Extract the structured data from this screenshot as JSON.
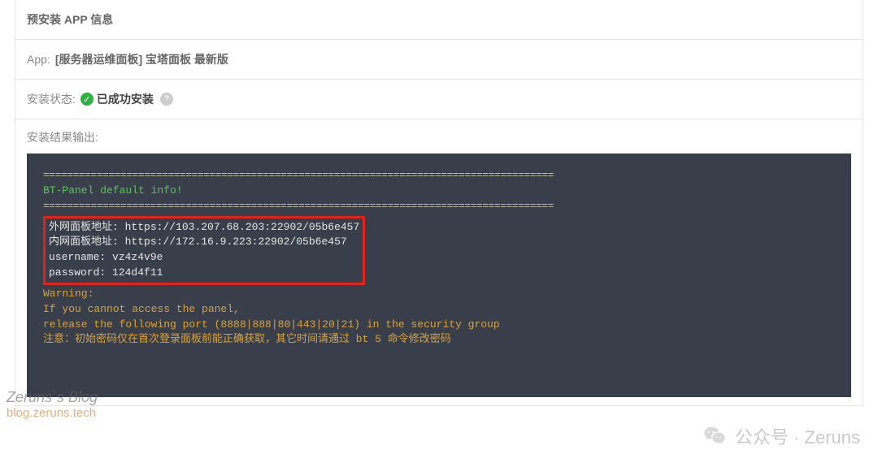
{
  "header": {
    "title": "预安装 APP 信息"
  },
  "app_row": {
    "label": "App:",
    "value": "[服务器运维面板] 宝塔面板 最新版"
  },
  "status_row": {
    "label": "安装状态:",
    "status_text": "已成功安装",
    "check_symbol": "✓",
    "help_symbol": "?"
  },
  "output": {
    "label": "安装结果输出:",
    "separator": "======================================================================================",
    "bt_info_header": "BT-Panel default info!",
    "credentials": {
      "external_url_label": "外网面板地址:",
      "external_url": "https://103.207.68.203:22902/05b6e457",
      "internal_url_label": "内网面板地址:",
      "internal_url": "https://172.16.9.223:22902/05b6e457",
      "username_label": "username:",
      "username": "vz4z4v9e",
      "password_label": "password:",
      "password": "124d4f11"
    },
    "warning": {
      "title": "Warning:",
      "line1": "If you cannot access the panel,",
      "line2": "release the following port (8888|888|80|443|20|21) in the security group",
      "notice": "注意：初始密码仅在首次登录面板前能正确获取，其它时间请通过 bt 5 命令修改密码"
    }
  },
  "watermark_left": {
    "line1": "Zeruns`s Blog",
    "line2": "blog.zeruns.tech"
  },
  "watermark_right": {
    "text": "公众号 · Zeruns"
  }
}
